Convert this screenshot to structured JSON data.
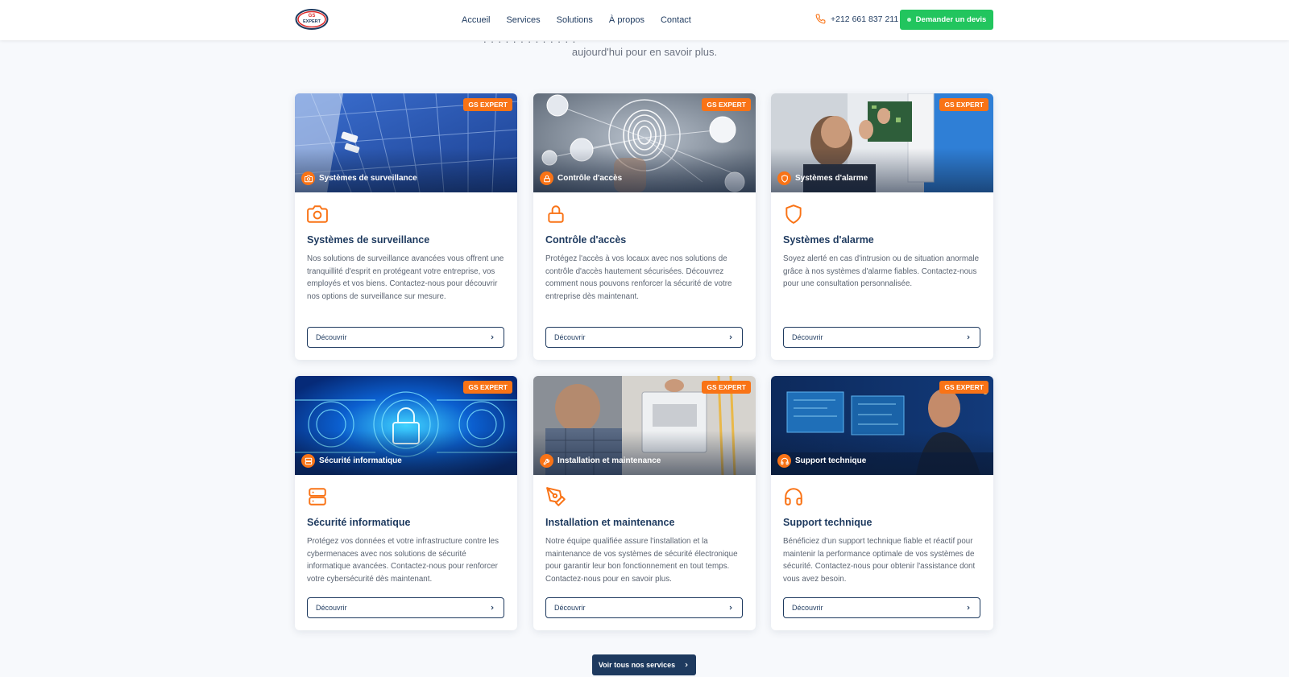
{
  "header": {
    "logo_text": "GS EXPERT",
    "nav": [
      "Accueil",
      "Services",
      "Solutions",
      "À propos",
      "Contact"
    ],
    "phone": "+212 661 837 211",
    "quote_button": "Demander un devis"
  },
  "intro": {
    "line": "aujourd'hui pour en savoir plus."
  },
  "badge_text": "GS EXPERT",
  "cards": [
    {
      "image_label": "Systèmes de surveillance",
      "icon": "camera-icon",
      "title": "Systèmes de surveillance",
      "description": "Nos solutions de surveillance avancées vous offrent une tranquillité d'esprit en protégeant votre entreprise, vos employés et vos biens. Contactez-nous pour découvrir nos options de surveillance sur mesure.",
      "button": "Découvrir"
    },
    {
      "image_label": "Contrôle d'accès",
      "icon": "lock-icon",
      "title": "Contrôle d'accès",
      "description": "Protégez l'accès à vos locaux avec nos solutions de contrôle d'accès hautement sécurisées. Découvrez comment nous pouvons renforcer la sécurité de votre entreprise dès maintenant.",
      "button": "Découvrir"
    },
    {
      "image_label": "Systèmes d'alarme",
      "icon": "shield-icon",
      "title": "Systèmes d'alarme",
      "description": "Soyez alerté en cas d'intrusion ou de situation anormale grâce à nos systèmes d'alarme fiables. Contactez-nous pour une consultation personnalisée.",
      "button": "Découvrir"
    },
    {
      "image_label": "Sécurité informatique",
      "icon": "server-icon",
      "title": "Sécurité informatique",
      "description": "Protégez vos données et votre infrastructure contre les cybermenaces avec nos solutions de sécurité informatique avancées. Contactez-nous pour renforcer votre cybersécurité dès maintenant.",
      "button": "Découvrir"
    },
    {
      "image_label": "Installation et maintenance",
      "icon": "tools-icon",
      "title": "Installation et maintenance",
      "description": "Notre équipe qualifiée assure l'installation et la maintenance de vos systèmes de sécurité électronique pour garantir leur bon fonctionnement en tout temps. Contactez-nous pour en savoir plus.",
      "button": "Découvrir"
    },
    {
      "image_label": "Support technique",
      "icon": "headset-icon",
      "title": "Support technique",
      "description": "Bénéficiez d'un support technique fiable et réactif pour maintenir la performance optimale de vos systèmes de sécurité. Contactez-nous pour obtenir l'assistance dont vous avez besoin.",
      "button": "Découvrir"
    }
  ],
  "all_services_button": "Voir tous nos services",
  "colors": {
    "navy": "#1e3a5f",
    "orange": "#f97316",
    "green": "#22c55e"
  }
}
